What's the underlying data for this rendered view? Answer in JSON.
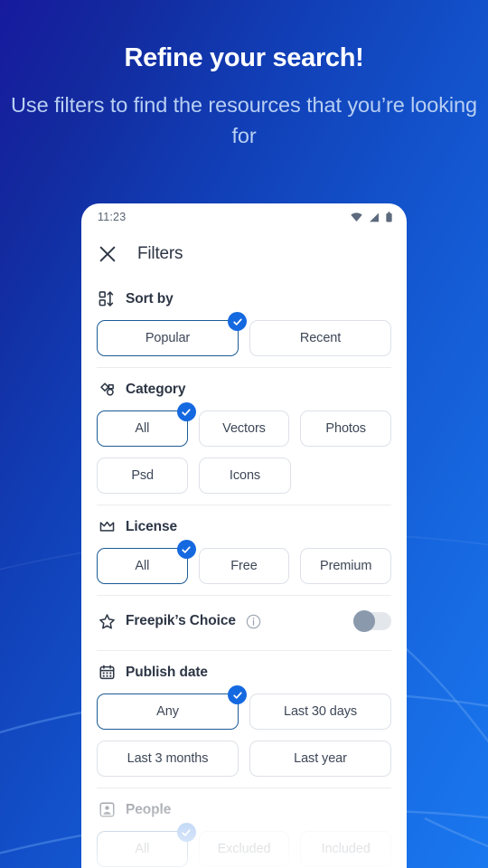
{
  "hero": {
    "title": "Refine your search!",
    "subtitle": "Use filters to find the resources that you’re looking for"
  },
  "colors": {
    "accent": "#1569e0",
    "selected_border": "#1b5b94",
    "chip_border": "#dde1e8",
    "text_dark": "#2d3645",
    "text_body": "#3d4757",
    "hero_subtitle": "#b8cff2",
    "bg_start": "#171a9e",
    "bg_end": "#1a78ef"
  },
  "phone": {
    "status_bar": {
      "time": "11:23",
      "icons": [
        "wifi-icon",
        "cell-signal-icon",
        "battery-icon"
      ]
    },
    "app_bar": {
      "close_icon": "close-icon",
      "title": "Filters"
    },
    "sections": [
      {
        "id": "sort-by",
        "icon": "sort-icon",
        "title": "Sort by",
        "rows": [
          [
            {
              "label": "Popular",
              "selected": true
            },
            {
              "label": "Recent",
              "selected": false
            }
          ]
        ]
      },
      {
        "id": "category",
        "icon": "shapes-icon",
        "title": "Category",
        "rows": [
          [
            {
              "label": "All",
              "selected": true
            },
            {
              "label": "Vectors",
              "selected": false
            },
            {
              "label": "Photos",
              "selected": false
            }
          ],
          [
            {
              "label": "Psd",
              "selected": false
            },
            {
              "label": "Icons",
              "selected": false
            }
          ]
        ]
      },
      {
        "id": "license",
        "icon": "crown-icon",
        "title": "License",
        "rows": [
          [
            {
              "label": "All",
              "selected": true
            },
            {
              "label": "Free",
              "selected": false
            },
            {
              "label": "Premium",
              "selected": false
            }
          ]
        ]
      },
      {
        "id": "publish-date",
        "icon": "calendar-icon",
        "title": "Publish date",
        "rows": [
          [
            {
              "label": "Any",
              "selected": true
            },
            {
              "label": "Last 30 days",
              "selected": false
            }
          ],
          [
            {
              "label": "Last 3 months",
              "selected": false
            },
            {
              "label": "Last year",
              "selected": false
            }
          ]
        ]
      },
      {
        "id": "people",
        "icon": "person-frame-icon",
        "title": "People",
        "rows": [
          [
            {
              "label": "All",
              "selected": true
            },
            {
              "label": "Excluded",
              "selected": false
            },
            {
              "label": "Included",
              "selected": false
            }
          ]
        ]
      }
    ],
    "freepiks_choice": {
      "icon": "star-icon",
      "label": "Freepik’s Choice",
      "info_icon": "info-icon",
      "toggle_name": "freepiks-choice-toggle",
      "toggle_on": false
    }
  }
}
